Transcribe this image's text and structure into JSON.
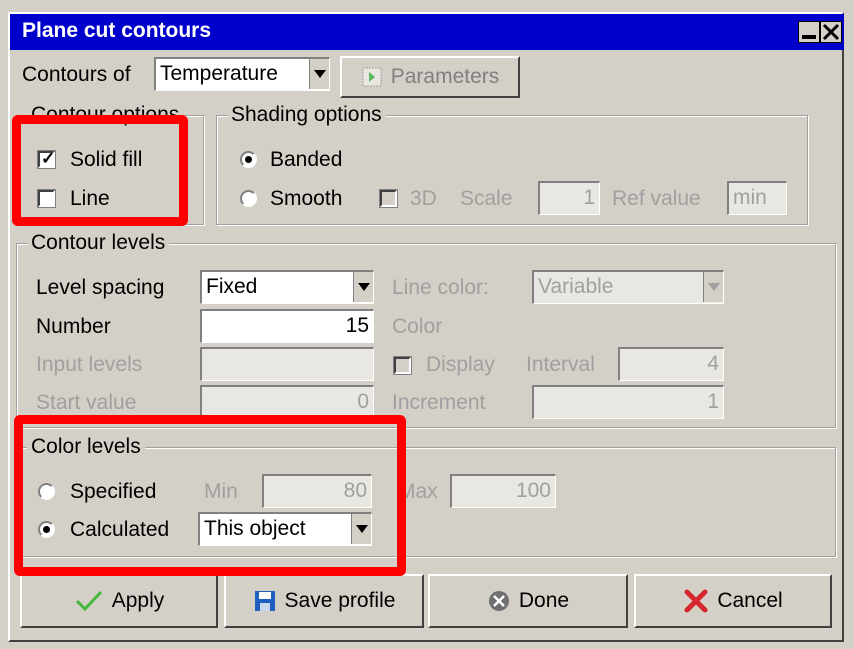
{
  "window": {
    "title": "Plane cut contours"
  },
  "header": {
    "contours_of_label": "Contours of",
    "contours_of_value": "Temperature",
    "parameters_button": "Parameters"
  },
  "contour_options": {
    "title": "Contour options",
    "solid_fill_label": "Solid fill",
    "solid_fill_checked": true,
    "line_label": "Line",
    "line_checked": false
  },
  "shading_options": {
    "title": "Shading options",
    "banded_label": "Banded",
    "smooth_label": "Smooth",
    "selected": "Banded",
    "three_d_label": "3D",
    "scale_label": "Scale",
    "scale_value": "1",
    "ref_value_label": "Ref value",
    "ref_value": "min"
  },
  "contour_levels": {
    "title": "Contour levels",
    "level_spacing_label": "Level spacing",
    "level_spacing_value": "Fixed",
    "line_color_label": "Line color:",
    "line_color_value": "Variable",
    "number_label": "Number",
    "number_value": "15",
    "color_label": "Color",
    "input_levels_label": "Input levels",
    "input_levels_value": "",
    "display_label": "Display",
    "interval_label": "Interval",
    "interval_value": "4",
    "start_value_label": "Start value",
    "start_value": "0",
    "increment_label": "Increment",
    "increment_value": "1"
  },
  "color_levels": {
    "title": "Color levels",
    "specified_label": "Specified",
    "calculated_label": "Calculated",
    "selected": "Calculated",
    "min_label": "Min",
    "min_value": "80",
    "max_label": "Max",
    "max_value": "100",
    "calculated_source": "This object"
  },
  "buttons": {
    "apply": "Apply",
    "save_profile": "Save profile",
    "done": "Done",
    "cancel": "Cancel"
  },
  "colors": {
    "titlebar": "#0000cc",
    "highlight": "#ff0000",
    "dialog_bg": "#d4d0c8"
  }
}
